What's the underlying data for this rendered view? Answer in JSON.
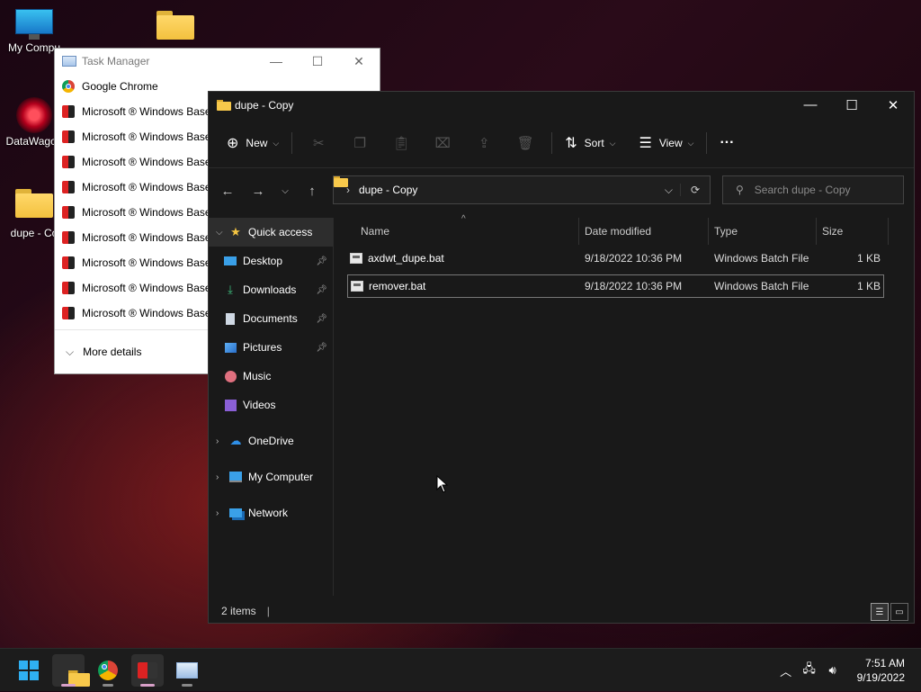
{
  "desktop": {
    "icons": [
      {
        "label": "My Compu",
        "icon": "monitor-icon"
      },
      {
        "label": "",
        "icon": "folder-icon"
      },
      {
        "label": "DataWagon",
        "icon": "datawagon-icon"
      },
      {
        "label": "dupe - Co",
        "icon": "folder-icon"
      }
    ]
  },
  "task_manager": {
    "title": "Task Manager",
    "controls": {
      "minimize": "—",
      "maximize": "☐",
      "close": "✕"
    },
    "processes": [
      "Google Chrome",
      "Microsoft ® Windows Base",
      "Microsoft ® Windows Base",
      "Microsoft ® Windows Base",
      "Microsoft ® Windows Base",
      "Microsoft ® Windows Base",
      "Microsoft ® Windows Base",
      "Microsoft ® Windows Base",
      "Microsoft ® Windows Base",
      "Microsoft ® Windows Base"
    ],
    "more_details": "More details"
  },
  "explorer": {
    "title": "dupe - Copy",
    "toolbar": {
      "new_label": "New",
      "sort_label": "Sort",
      "view_label": "View",
      "more": "···"
    },
    "address": {
      "path": "dupe - Copy"
    },
    "search": {
      "placeholder": "Search dupe - Copy"
    },
    "nav": {
      "quick_access": "Quick access",
      "desktop": "Desktop",
      "downloads": "Downloads",
      "documents": "Documents",
      "pictures": "Pictures",
      "music": "Music",
      "videos": "Videos",
      "onedrive": "OneDrive",
      "my_computer": "My Computer",
      "network": "Network"
    },
    "columns": {
      "name": "Name",
      "date": "Date modified",
      "type": "Type",
      "size": "Size"
    },
    "files": [
      {
        "name": "axdwt_dupe.bat",
        "date": "9/18/2022 10:36 PM",
        "type": "Windows Batch File",
        "size": "1 KB"
      },
      {
        "name": "remover.bat",
        "date": "9/18/2022 10:36 PM",
        "type": "Windows Batch File",
        "size": "1 KB"
      }
    ],
    "status": "2 items"
  },
  "taskbar": {
    "apps": [
      "windows-start",
      "file-explorer",
      "google-chrome",
      "windows-base-app",
      "task-manager"
    ],
    "time": "7:51 AM",
    "date": "9/19/2022"
  },
  "colors": {
    "accent": "#2fb0f2",
    "folder": "#f8c94b",
    "explorer_bg": "#191919"
  }
}
